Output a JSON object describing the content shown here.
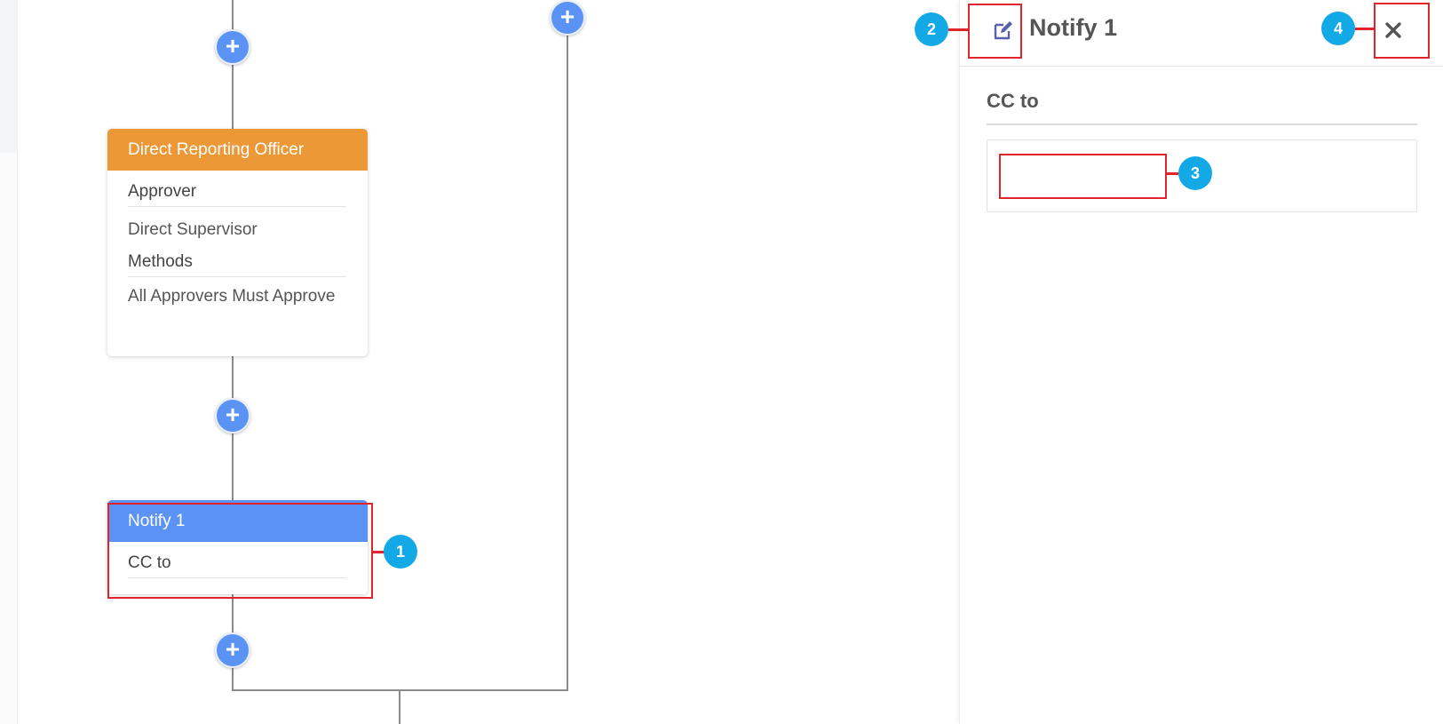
{
  "colors": {
    "accent_blue": "#5b93f5",
    "approver_header": "#ec9837",
    "annotation_red": "#e0242a",
    "callout_blue": "#13a9e6"
  },
  "workflow": {
    "add_step_icon": "+",
    "approver_node": {
      "title": "Direct Reporting Officer",
      "approver_label": "Approver",
      "approver_value": "Direct Supervisor",
      "methods_label": "Methods",
      "methods_value": "All Approvers Must Approve"
    },
    "notify_node": {
      "title": "Notify 1",
      "cc_label": "CC to"
    }
  },
  "panel": {
    "edit_icon": "edit-icon",
    "title": "Notify 1",
    "close_icon": "close-icon",
    "section_label": "CC to",
    "cc_value": ""
  },
  "callouts": {
    "one": "1",
    "two": "2",
    "three": "3",
    "four": "4"
  }
}
